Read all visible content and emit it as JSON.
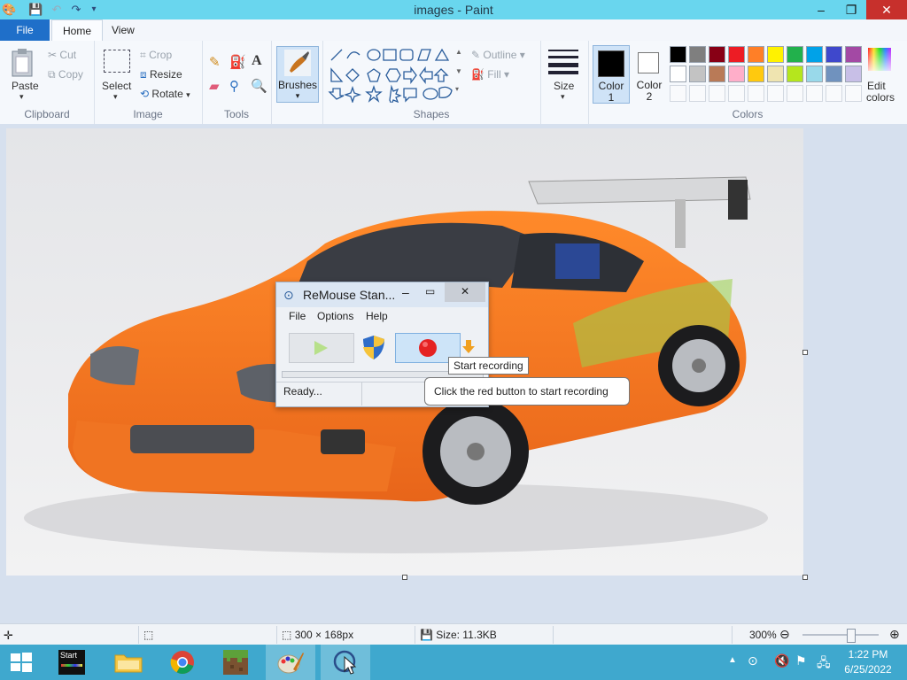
{
  "window": {
    "title": "images - Paint"
  },
  "tabs": {
    "file": "File",
    "home": "Home",
    "view": "View"
  },
  "ribbon": {
    "clipboard": {
      "paste": "Paste",
      "cut": "Cut",
      "copy": "Copy",
      "label": "Clipboard"
    },
    "image": {
      "select": "Select",
      "crop": "Crop",
      "resize": "Resize",
      "rotate": "Rotate",
      "label": "Image"
    },
    "tools": {
      "label": "Tools"
    },
    "brushes": {
      "label": "Brushes"
    },
    "shapes": {
      "outline": "Outline",
      "fill": "Fill",
      "label": "Shapes"
    },
    "size": {
      "label": "Size"
    },
    "colors": {
      "color1": "Color",
      "color1_num": "1",
      "color2": "Color",
      "color2_num": "2",
      "edit_line1": "Edit",
      "edit_line2": "colors",
      "label": "Colors",
      "color1_value": "#000000",
      "color2_value": "#ffffff",
      "palette_row1": [
        "#000000",
        "#7f7f7f",
        "#880015",
        "#ed1c24",
        "#ff7f27",
        "#fff200",
        "#22b14c",
        "#00a2e8",
        "#3f48cc",
        "#a349a4"
      ],
      "palette_row2": [
        "#ffffff",
        "#c3c3c3",
        "#b97a57",
        "#ffaec9",
        "#ffc90e",
        "#efe4b0",
        "#b5e61d",
        "#99d9ea",
        "#7092be",
        "#c8bfe7"
      ]
    }
  },
  "remouse": {
    "title": "ReMouse Stan...",
    "menu": [
      "File",
      "Options",
      "Help"
    ],
    "status": "Ready...",
    "tooltip": "Start recording",
    "balloon": "Click the red button to start recording"
  },
  "statusbar": {
    "dimensions": "300 × 168px",
    "size": "Size: 11.3KB",
    "zoom": "300%"
  },
  "taskbar": {
    "start_tile": "Start",
    "time": "1:22 PM",
    "date": "6/25/2022"
  }
}
